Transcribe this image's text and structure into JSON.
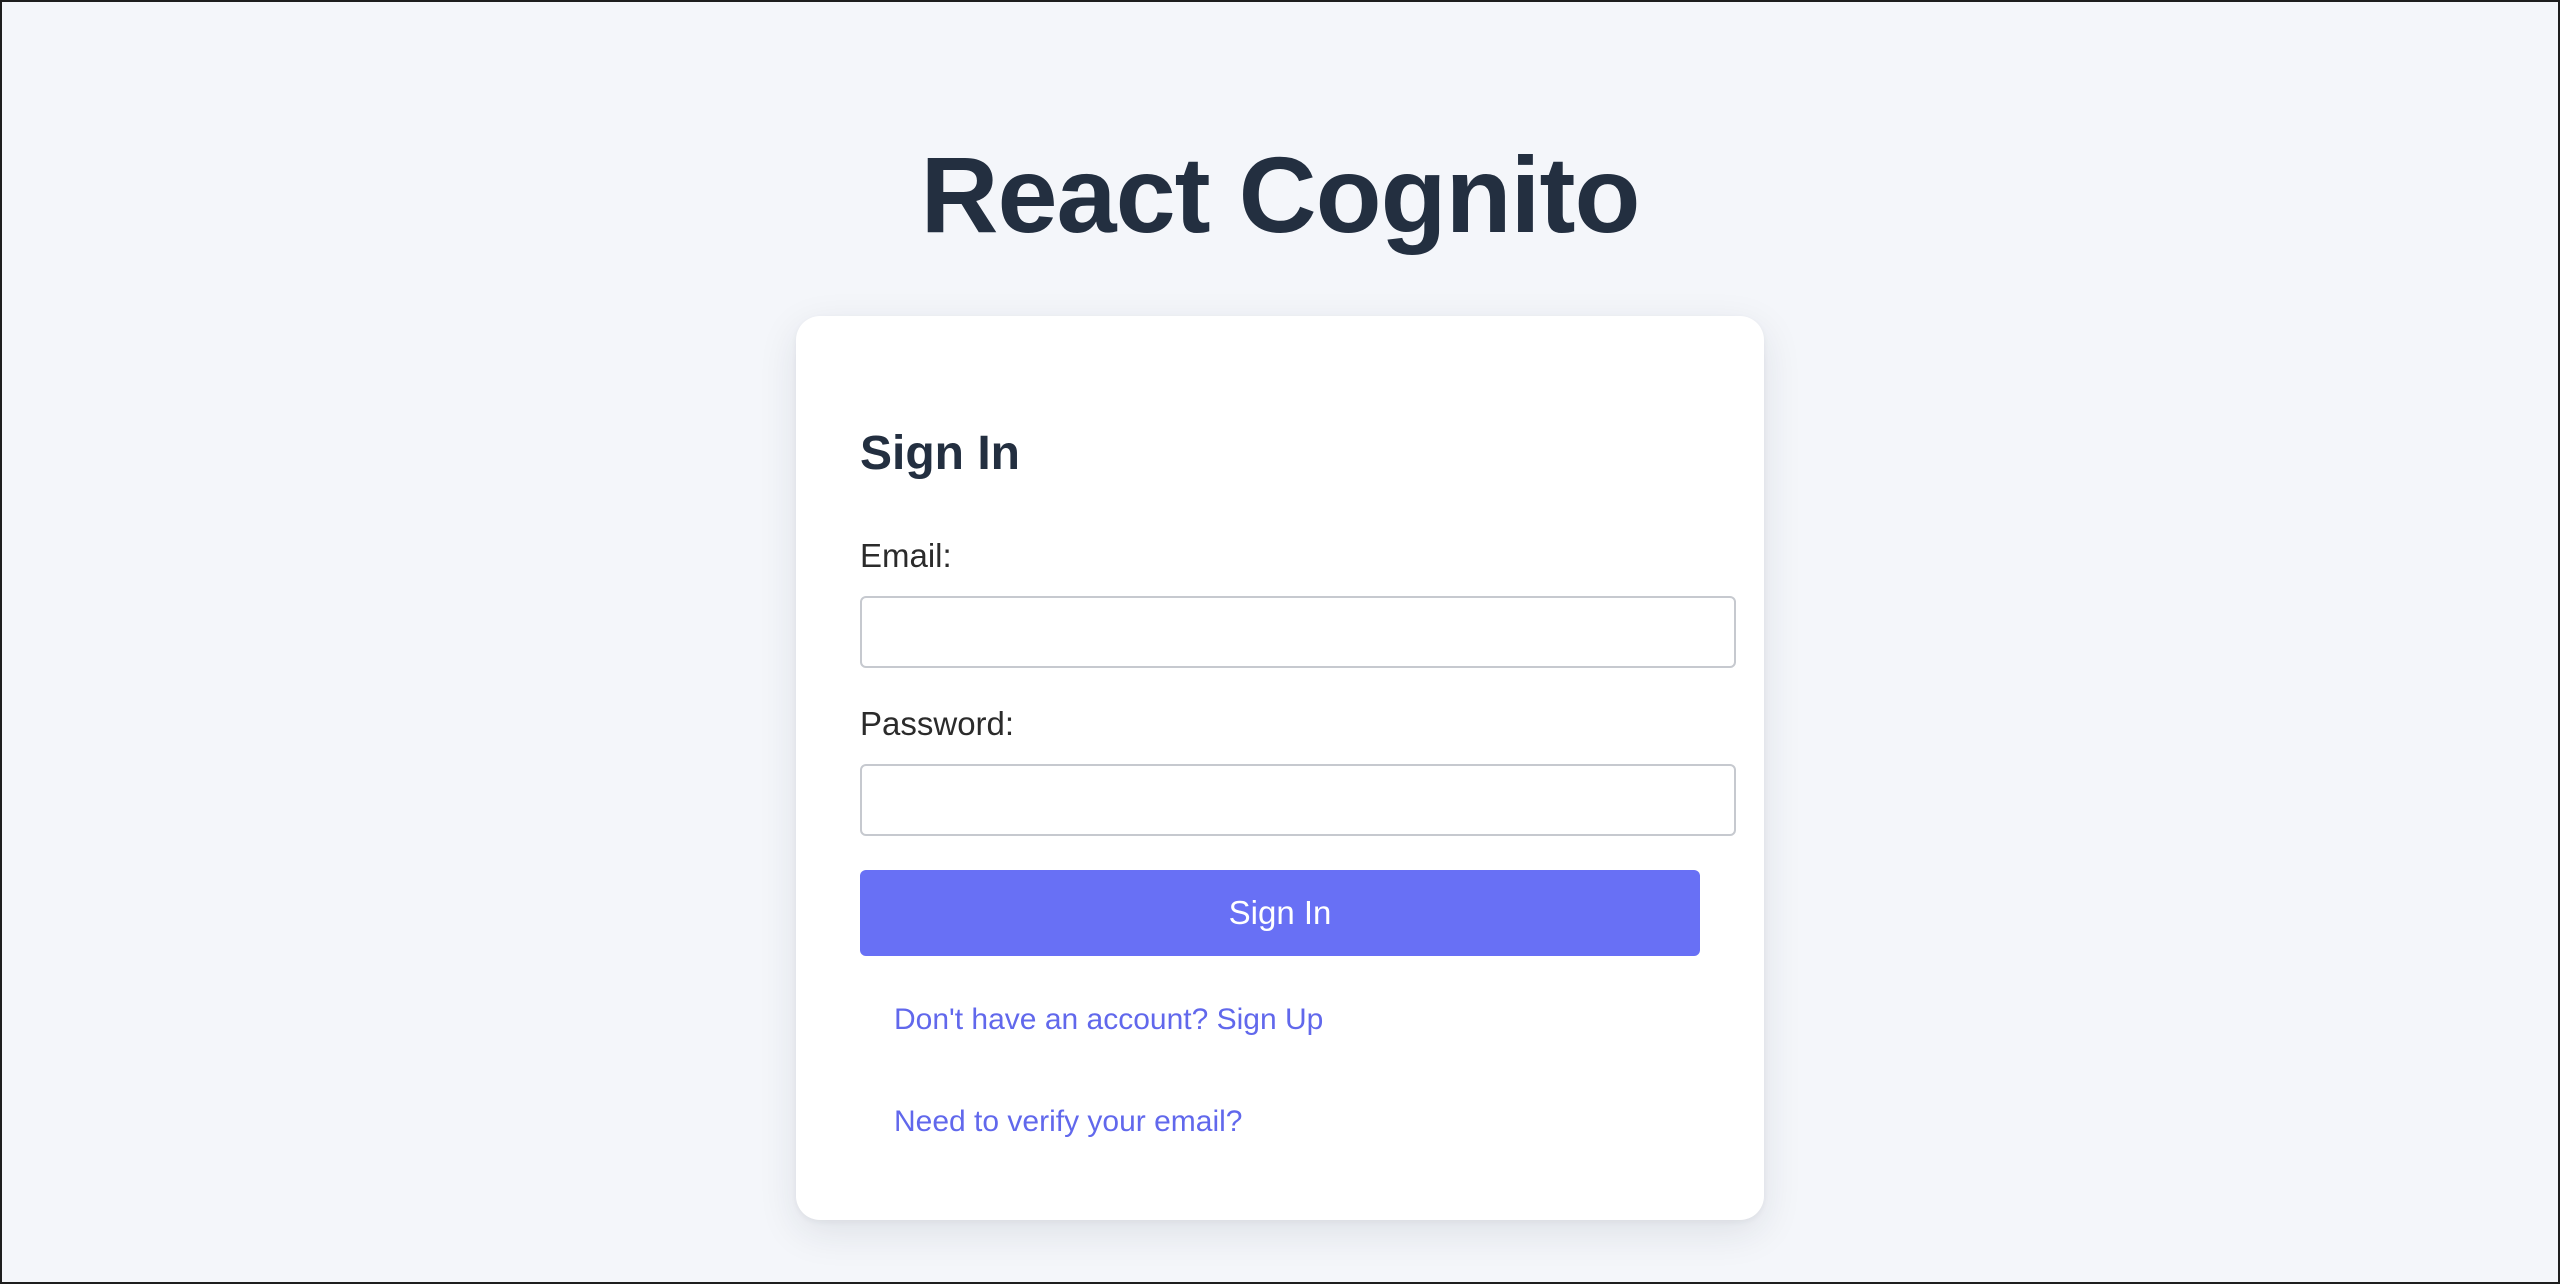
{
  "header": {
    "title": "React Cognito"
  },
  "signin_form": {
    "title": "Sign In",
    "email": {
      "label": "Email:",
      "value": "",
      "placeholder": ""
    },
    "password": {
      "label": "Password:",
      "value": "",
      "placeholder": ""
    },
    "submit_label": "Sign In",
    "signup_link": "Don't have an account? Sign Up",
    "verify_link": "Need to verify your email?"
  },
  "colors": {
    "page_background": "#f4f6fa",
    "card_background": "#ffffff",
    "heading_text": "#232f40",
    "primary_button": "#6870f5",
    "link_text": "#6168ec",
    "input_border": "#c6c9cf"
  }
}
